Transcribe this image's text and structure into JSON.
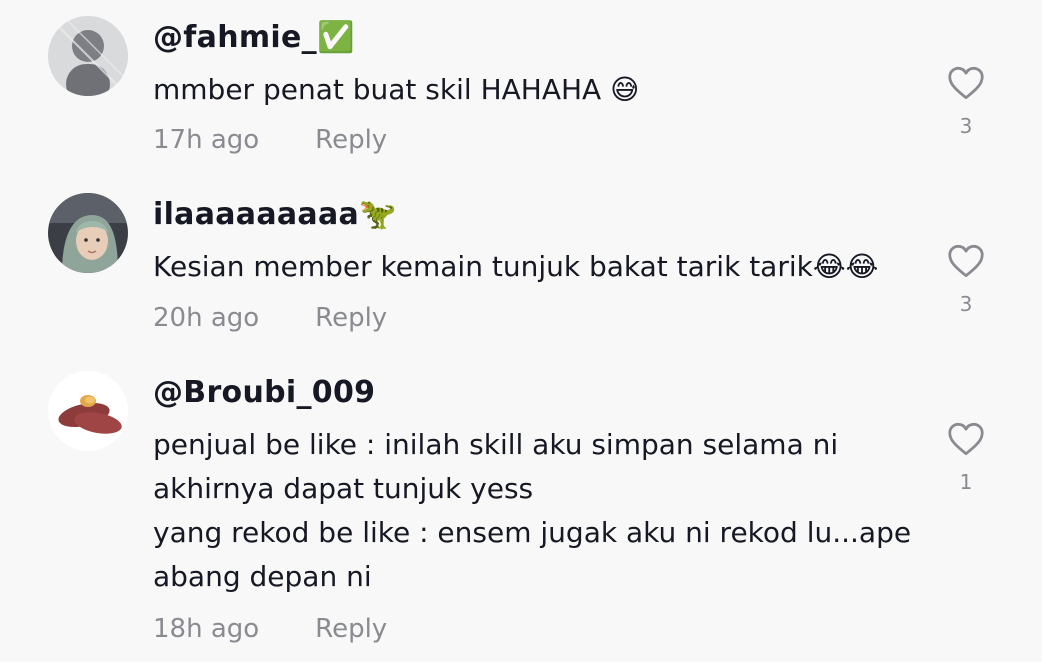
{
  "comments": [
    {
      "username": "@fahmie_✅",
      "text": "mmber penat buat skil HAHAHA 😅",
      "time": "17h ago",
      "reply": "Reply",
      "likes": "3",
      "avatar_icon": "avatar-gray-figure"
    },
    {
      "username": "ilaaaaaaaaa🦖",
      "text": "Kesian member kemain tunjuk bakat tarik tarik😂😂",
      "time": "20h ago",
      "reply": "Reply",
      "likes": "3",
      "avatar_icon": "avatar-photo-person"
    },
    {
      "username": "@Broubi_009",
      "text": "penjual be like : inilah skill aku simpan selama ni\nakhirnya dapat tunjuk yess\nyang rekod be like : ensem jugak aku ni rekod lu...ape\nabang depan ni",
      "time": "18h ago",
      "reply": "Reply",
      "likes": "1",
      "avatar_icon": "avatar-sweet-potato"
    }
  ],
  "icons": {
    "like": "heart-outline-icon"
  },
  "colors": {
    "background": "#f8f8f8",
    "text": "#161823",
    "muted": "#8a8b91"
  }
}
